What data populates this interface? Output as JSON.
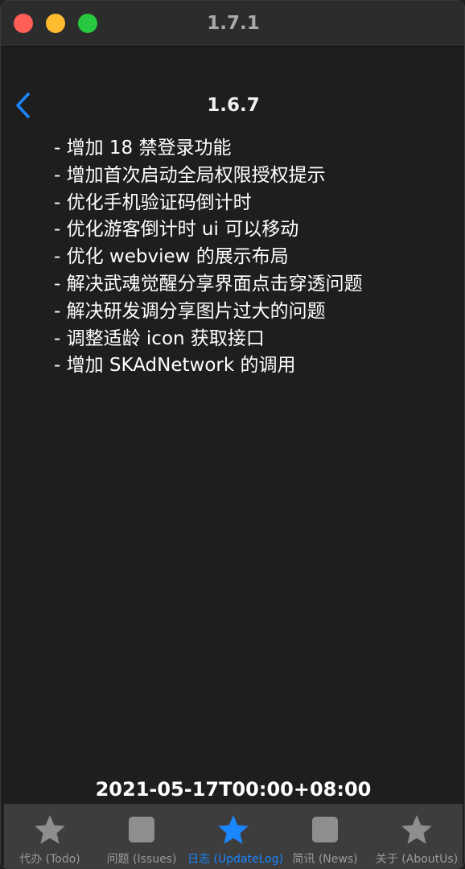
{
  "window": {
    "title": "1.7.1"
  },
  "nav": {
    "title": "1.6.7",
    "back_icon": "chevron-left-icon"
  },
  "changelog": [
    "- 增加 18 禁登录功能",
    "- 增加首次启动全局权限授权提示",
    "- 优化手机验证码倒计时",
    "- 优化游客倒计时 ui 可以移动",
    "- 优化 webview 的展示布局",
    "- 解决武魂觉醒分享界面点击穿透问题",
    "- 解决研发调分享图片过大的问题",
    "- 调整适龄 icon 获取接口",
    "- 增加 SKAdNetwork 的调用"
  ],
  "date": "2021-05-17T00:00+08:00",
  "tabs": [
    {
      "label": "代办 (Todo)",
      "icon": "star-icon",
      "active": false
    },
    {
      "label": "问题 (Issues)",
      "icon": "square-icon",
      "active": false
    },
    {
      "label": "日志 (UpdateLog)",
      "icon": "star-icon",
      "active": true
    },
    {
      "label": "简讯 (News)",
      "icon": "square-icon",
      "active": false
    },
    {
      "label": "关于 (AboutUs)",
      "icon": "star-icon",
      "active": false
    }
  ],
  "colors": {
    "accent": "#1a86ff",
    "inactive_icon": "#8e8e8e",
    "background": "#1e1e1e",
    "tabbar": "#3d3d3d",
    "close": "#ff5f57",
    "minimize": "#febc2e",
    "maximize": "#28c840"
  }
}
